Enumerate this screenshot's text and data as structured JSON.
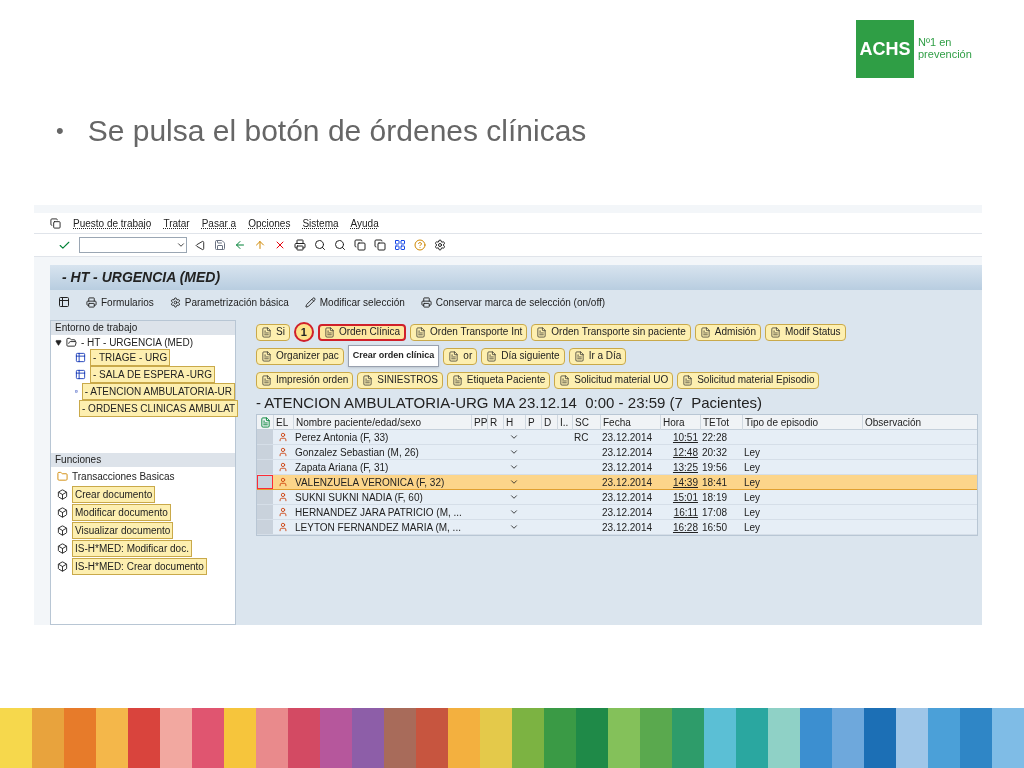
{
  "logo": {
    "name": "ACHS",
    "tagline": "Nº1 en prevención"
  },
  "bullet": {
    "marker": "•",
    "text": "Se pulsa el botón de órdenes clínicas"
  },
  "sap": {
    "menu": [
      "Puesto de trabajo",
      "Tratar",
      "Pasar a",
      "Opciones",
      "Sistema",
      "Ayuda"
    ],
    "title": "- HT - URGENCIA (MED)",
    "app_toolbar": [
      "Formularios",
      "Parametrización básica",
      "Modificar selección",
      "Conservar marca de selección (on/off)"
    ],
    "workspace": {
      "header": "Entorno de trabajo",
      "root": {
        "label": "- HT - URGENCIA (MED)",
        "expanded": true,
        "children": [
          {
            "label": "- TRIAGE - URG"
          },
          {
            "label": "- SALA DE ESPERA -URG"
          },
          {
            "label": "- ATENCION AMBULATORIA-UR"
          },
          {
            "label": "- ORDENES CLINICAS AMBULAT"
          }
        ]
      }
    },
    "functions": {
      "header": "Funciones",
      "items": [
        {
          "kind": "folder",
          "label": "Transacciones Basicas"
        },
        {
          "kind": "action",
          "label": "Crear documento"
        },
        {
          "kind": "action",
          "label": "Modificar documento"
        },
        {
          "kind": "action",
          "label": "Visualizar documento"
        },
        {
          "kind": "action",
          "label": "IS-H*MED: Modificar doc."
        },
        {
          "kind": "action",
          "label": "IS-H*MED: Crear documento"
        }
      ]
    },
    "button_rows": [
      [
        {
          "label": "Si",
          "highlighted": false
        },
        {
          "label": "Orden Clínica",
          "highlighted": true
        },
        {
          "label": "Orden Transporte Int",
          "highlighted": false
        },
        {
          "label": "Orden Transporte sin paciente",
          "highlighted": false
        },
        {
          "label": "Admisión",
          "highlighted": false
        },
        {
          "label": "Modif Status",
          "highlighted": false
        }
      ],
      [
        {
          "label": "Organizer pac",
          "highlighted": false
        },
        {
          "label": "or",
          "highlighted": false
        },
        {
          "label": "Día siguiente",
          "highlighted": false
        },
        {
          "label": "Ir a Día",
          "highlighted": false
        }
      ],
      [
        {
          "label": "Impresión orden",
          "highlighted": false
        },
        {
          "label": "SINIESTROS",
          "highlighted": false
        },
        {
          "label": "Etiqueta Paciente",
          "highlighted": false
        },
        {
          "label": "Solicitud material UO",
          "highlighted": false
        },
        {
          "label": "Solicitud material Episodio",
          "highlighted": false
        }
      ]
    ],
    "callout": "1",
    "tooltip": "Crear orden clínica",
    "list_title": "- ATENCION AMBULATORIA-URG MA 23.12.14  0:00 - 23:59 (7  Pacientes)",
    "table": {
      "columns": [
        "EL",
        "Nombre paciente/edad/sexo",
        "PP",
        "R",
        "H",
        "P",
        "D",
        "I..",
        "SC",
        "Fecha",
        "Hora",
        "TETot",
        "Tipo de episodio",
        "Observación"
      ],
      "rows": [
        {
          "name": "Perez Antonia (F, 33)",
          "sc": "RC",
          "fecha": "23.12.2014",
          "hora": "10:51",
          "tetot": "22:28",
          "tipo": "",
          "selected": false
        },
        {
          "name": "Gonzalez Sebastian (M, 26)",
          "sc": "",
          "fecha": "23.12.2014",
          "hora": "12:48",
          "tetot": "20:32",
          "tipo": "Ley",
          "selected": false
        },
        {
          "name": "Zapata Ariana (F, 31)",
          "sc": "",
          "fecha": "23.12.2014",
          "hora": "13:25",
          "tetot": "19:56",
          "tipo": "Ley",
          "selected": false
        },
        {
          "name": "VALENZUELA VERONICA (F, 32)",
          "sc": "",
          "fecha": "23.12.2014",
          "hora": "14:39",
          "tetot": "18:41",
          "tipo": "Ley",
          "selected": true
        },
        {
          "name": "SUKNI SUKNI NADIA (F, 60)",
          "sc": "",
          "fecha": "23.12.2014",
          "hora": "15:01",
          "tetot": "18:19",
          "tipo": "Ley",
          "selected": false
        },
        {
          "name": "HERNANDEZ JARA PATRICIO (M, ...",
          "sc": "",
          "fecha": "23.12.2014",
          "hora": "16:11",
          "tetot": "17:08",
          "tipo": "Ley",
          "selected": false
        },
        {
          "name": "LEYTON FERNANDEZ MARIA (M, ...",
          "sc": "",
          "fecha": "23.12.2014",
          "hora": "16:28",
          "tetot": "16:50",
          "tipo": "Ley",
          "selected": false
        }
      ]
    }
  }
}
